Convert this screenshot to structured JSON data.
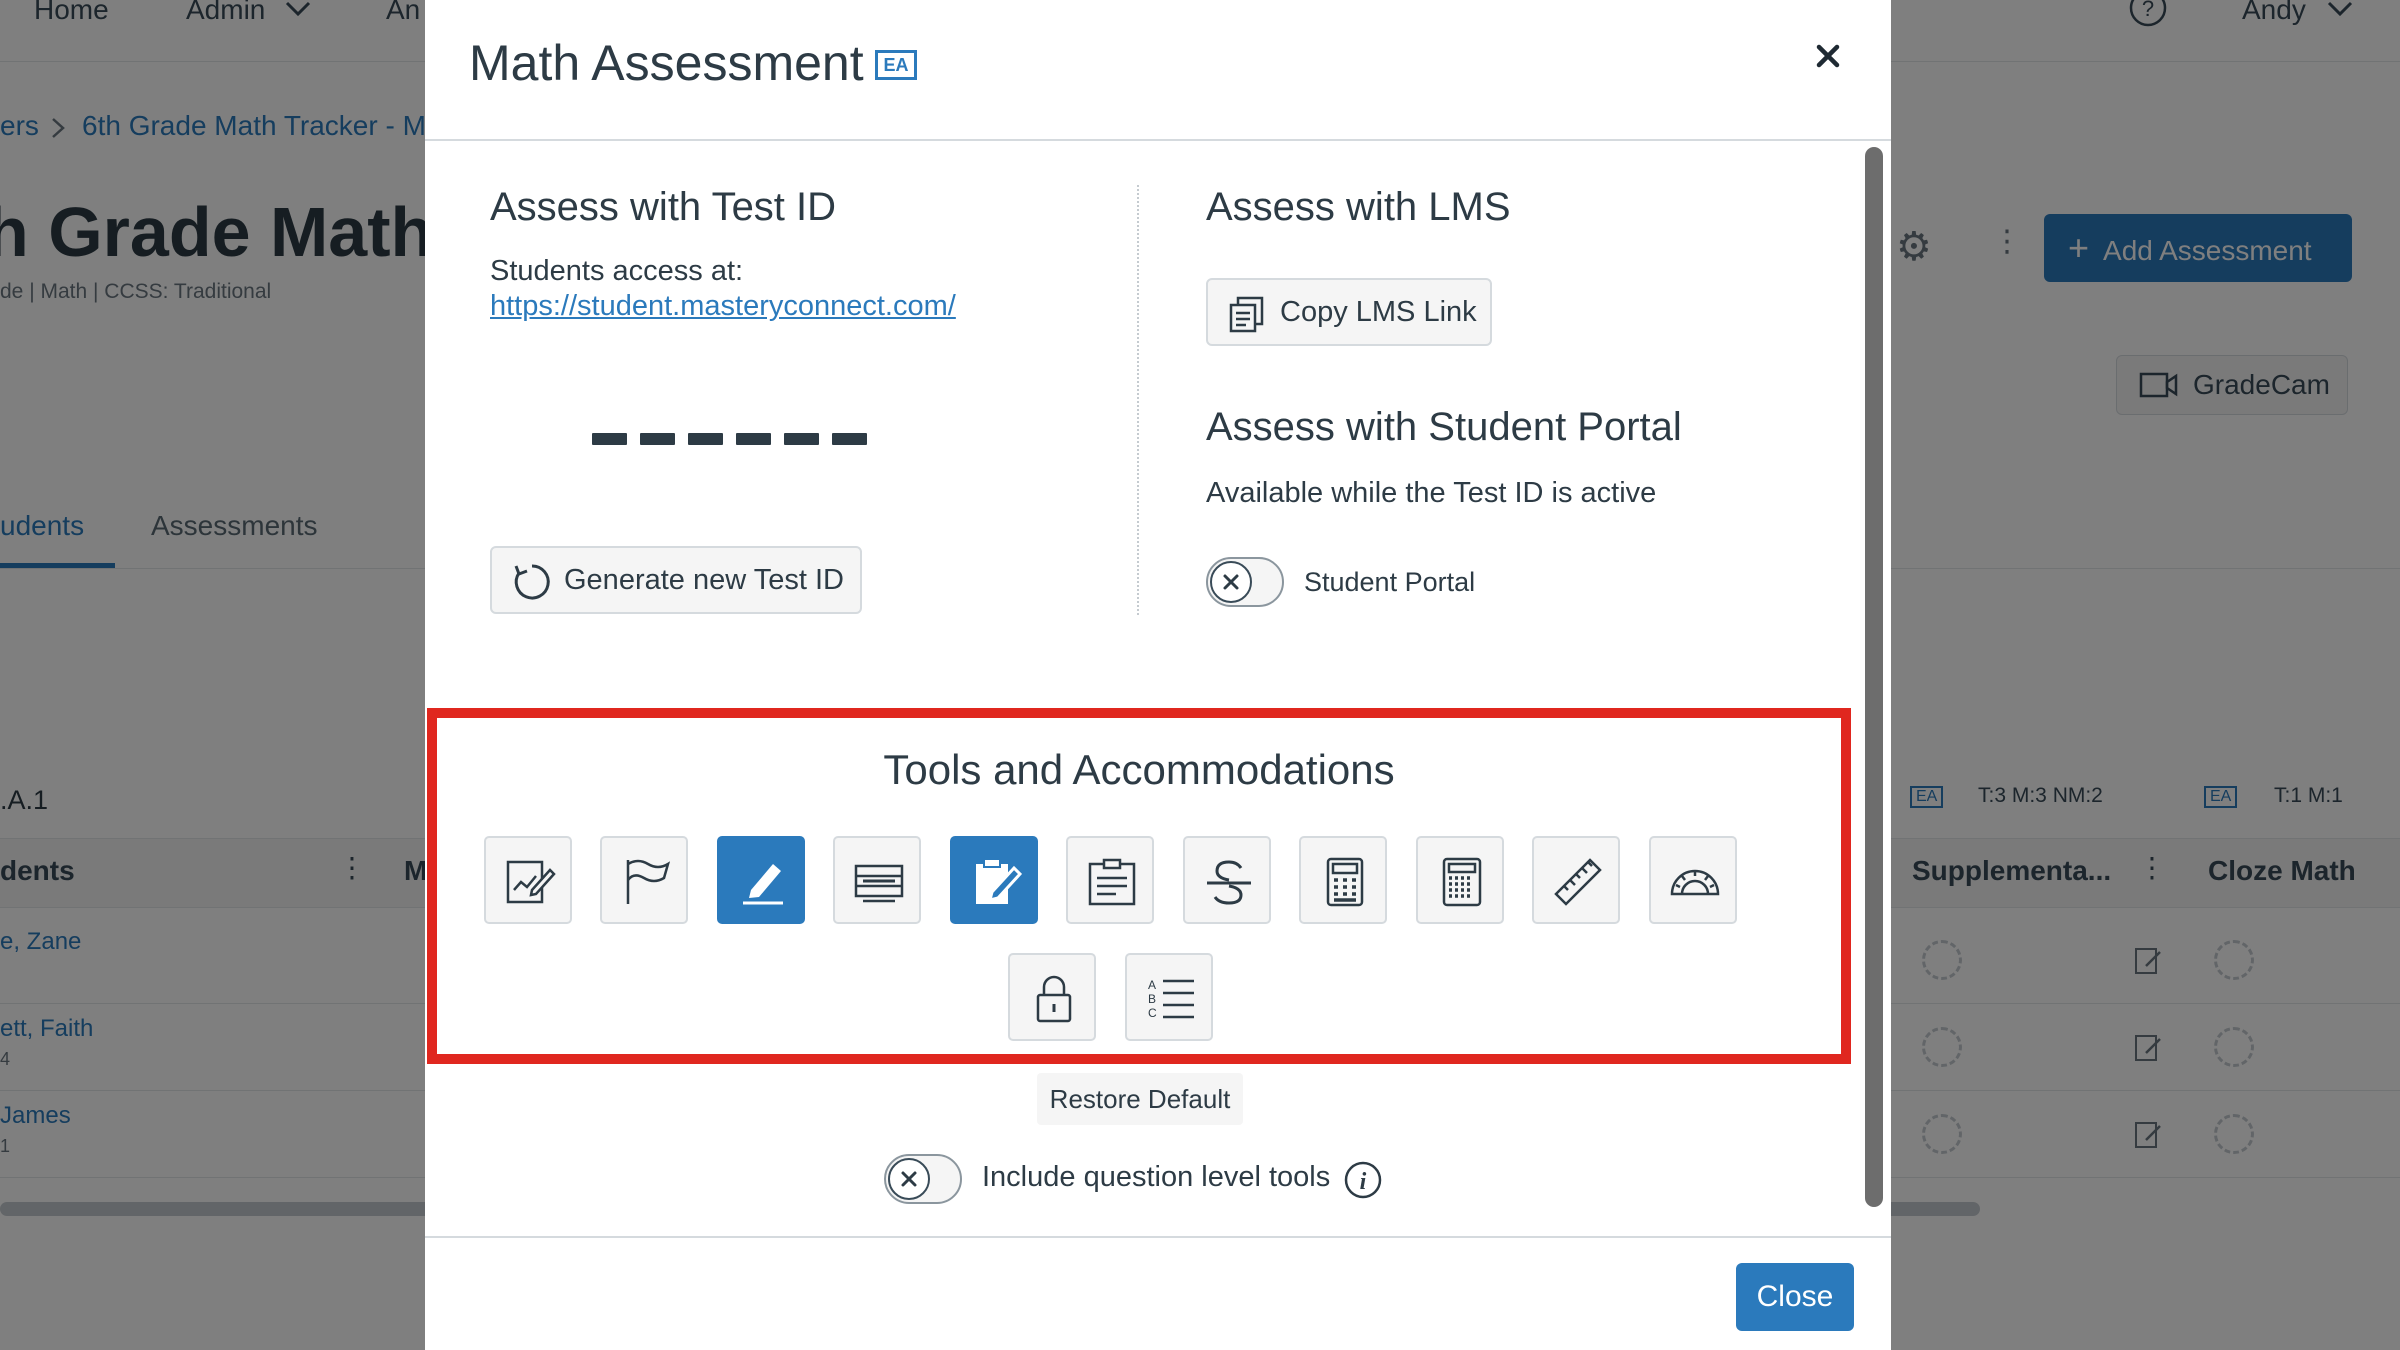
{
  "background": {
    "nav": {
      "home": "Home",
      "admin": "Admin",
      "analytics": "An",
      "user": "Andy"
    },
    "breadcrumb": {
      "prev": "ers",
      "current": "6th Grade Math Tracker - M"
    },
    "page_title": "h Grade Math",
    "page_subtitle": "de  |  Math  |  CCSS: Traditional",
    "add_assessment": "Add Assessment",
    "gradecam": "GradeCam",
    "tabs": {
      "students": "udents",
      "assessments": "Assessments"
    },
    "standard_code": ".A.1",
    "grid": {
      "students_header": "dents",
      "col_m": "M",
      "supplemental_header": "Supplementa...",
      "cloze_header": "Cloze Math",
      "ea_label": "EA",
      "meta_1": "T:3 M:3 NM:2",
      "meta_2": "T:1 M:1",
      "rows": [
        {
          "name": "e, Zane",
          "sub": ""
        },
        {
          "name": "ett, Faith",
          "sub": "4"
        },
        {
          "name": "James",
          "sub": "1"
        }
      ]
    }
  },
  "modal": {
    "title": "Math Assessment",
    "badge": "EA",
    "test_id": {
      "heading": "Assess with Test ID",
      "access_label": "Students access at:",
      "url": "https://student.masteryconnect.com/",
      "url_suffix": ".",
      "generate_button": "Generate new Test ID"
    },
    "lms": {
      "heading": "Assess with LMS",
      "copy_button": "Copy LMS Link"
    },
    "portal": {
      "heading": "Assess with Student Portal",
      "note": "Available while the Test ID is active",
      "toggle_label": "Student Portal",
      "toggle_on": false
    },
    "tools": {
      "heading": "Tools and Accommodations",
      "items": [
        {
          "icon": "notepad-edit-icon",
          "active": false
        },
        {
          "icon": "flag-icon",
          "active": false
        },
        {
          "icon": "highlighter-icon",
          "active": true
        },
        {
          "icon": "line-reader-icon",
          "active": false
        },
        {
          "icon": "clipboard-edit-icon",
          "active": true
        },
        {
          "icon": "notes-icon",
          "active": false
        },
        {
          "icon": "strikethrough-icon",
          "active": false
        },
        {
          "icon": "basic-calculator-icon",
          "active": false
        },
        {
          "icon": "scientific-calculator-icon",
          "active": false
        },
        {
          "icon": "ruler-icon",
          "active": false
        },
        {
          "icon": "protractor-icon",
          "active": false
        },
        {
          "icon": "lock-icon",
          "active": false
        },
        {
          "icon": "answer-eliminator-icon",
          "active": false
        }
      ],
      "restore_button": "Restore Default",
      "question_level_label": "Include question level tools",
      "question_level_on": false
    },
    "close_button": "Close"
  },
  "colors": {
    "accent": "#2b7abc",
    "highlight_border": "#e0271f",
    "text": "#2d3b45"
  }
}
